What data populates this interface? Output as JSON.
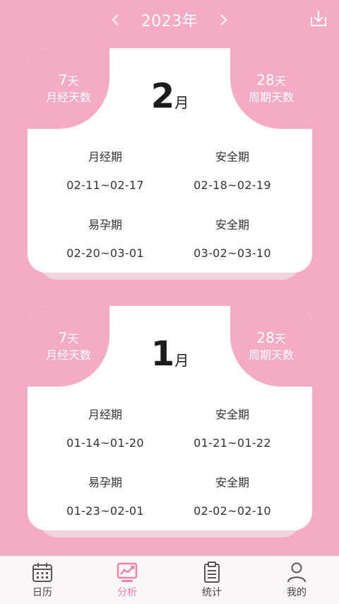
{
  "header": {
    "year": "2023年"
  },
  "cards": [
    {
      "month_num": "2",
      "month_unit": "月",
      "left": {
        "num": "7",
        "unit": "天",
        "label": "月经天数"
      },
      "right": {
        "num": "28",
        "unit": "天",
        "label": "周期天数"
      },
      "cells": [
        {
          "title": "月经期",
          "range": "02-11~02-17"
        },
        {
          "title": "安全期",
          "range": "02-18~02-19"
        },
        {
          "title": "易孕期",
          "range": "02-20~03-01"
        },
        {
          "title": "安全期",
          "range": "03-02~03-10"
        }
      ]
    },
    {
      "month_num": "1",
      "month_unit": "月",
      "left": {
        "num": "7",
        "unit": "天",
        "label": "月经天数"
      },
      "right": {
        "num": "28",
        "unit": "天",
        "label": "周期天数"
      },
      "cells": [
        {
          "title": "月经期",
          "range": "01-14~01-20"
        },
        {
          "title": "安全期",
          "range": "01-21~01-22"
        },
        {
          "title": "易孕期",
          "range": "01-23~02-01"
        },
        {
          "title": "安全期",
          "range": "02-02~02-10"
        }
      ]
    }
  ],
  "tabs": [
    {
      "label": "日历",
      "icon": "calendar-icon"
    },
    {
      "label": "分析",
      "icon": "chart-icon",
      "active": true
    },
    {
      "label": "统计",
      "icon": "clipboard-icon"
    },
    {
      "label": "我的",
      "icon": "user-icon"
    }
  ],
  "colors": {
    "background": "#f4abc3",
    "active_tab": "#ef82a8"
  }
}
